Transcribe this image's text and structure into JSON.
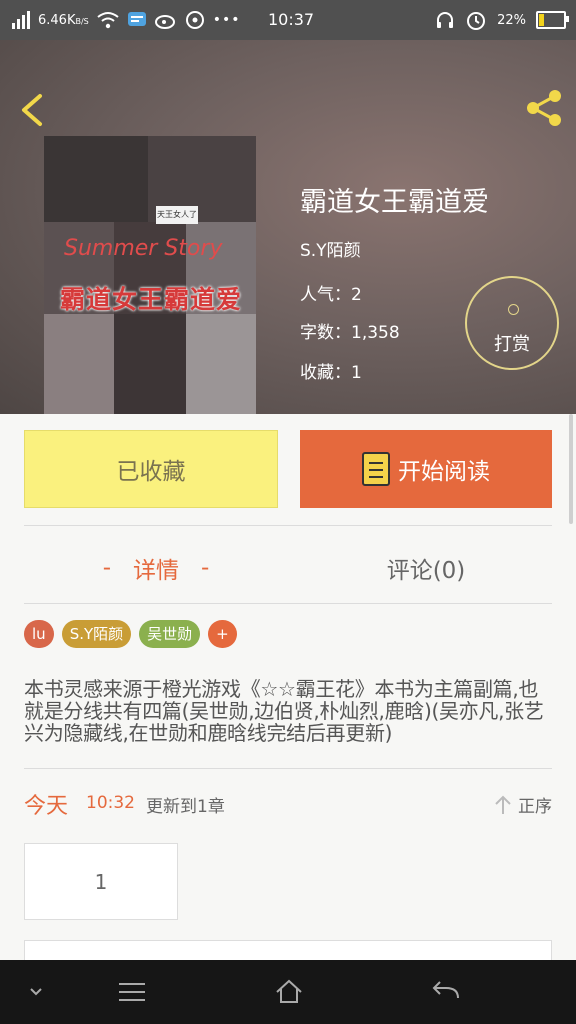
{
  "status_bar": {
    "net_speed": "6.46K",
    "net_unit": "B/S",
    "time": "10:37",
    "battery": "22%",
    "battery_level": 0.22
  },
  "book": {
    "title": "霸道女王霸道爱",
    "author": "S.Y陌颜",
    "popularity": "人气：2",
    "word_count": "字数：1,358",
    "favorites": "收藏：1",
    "reward_label": "打赏",
    "cover": {
      "overlay_en": "Summer Story",
      "overlay_cn": "霸道女王霸道爱",
      "caption": "天王女人了"
    }
  },
  "actions": {
    "collected_label": "已收藏",
    "read_label": "开始阅读"
  },
  "tabs": {
    "detail": "详情",
    "detail_dash": "-",
    "comment": "评论(0)"
  },
  "tags": [
    {
      "label": "lu",
      "color": "#d8674a"
    },
    {
      "label": "S.Y陌颜",
      "color": "#c99d36"
    },
    {
      "label": "吴世勋",
      "color": "#8bb04e"
    },
    {
      "label": "+",
      "color": "#e5693d"
    }
  ],
  "description": "本书灵感来源于橙光游戏《☆☆霸王花》本书为主篇副篇,也就是分线共有四篇(吴世勋,边伯贤,朴灿烈,鹿晗)(吴亦凡,张艺兴为隐藏线,在世勋和鹿晗线完结后再更新)",
  "update": {
    "today": "今天",
    "time": "10:32",
    "text": "更新到1章",
    "sort_label": "正序"
  },
  "chapters": [
    "1"
  ]
}
